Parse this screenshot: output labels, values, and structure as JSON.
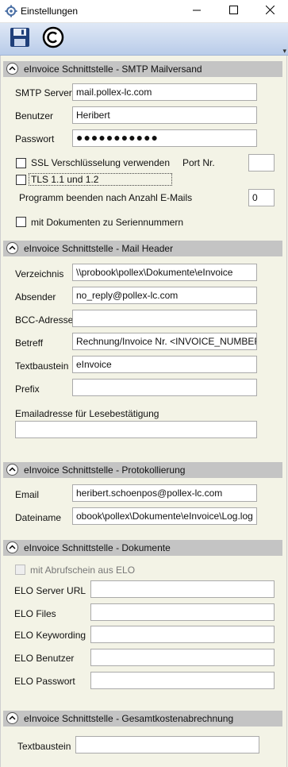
{
  "window": {
    "title": "Einstellungen"
  },
  "toolbar": {
    "overflow_glyph": "▾"
  },
  "smtp": {
    "header": "eInvoice Schnittstelle - SMTP Mailversand",
    "server_label": "SMTP Server",
    "server_value": "mail.pollex-lc.com",
    "user_label": "Benutzer",
    "user_value": "Heribert",
    "password_label": "Passwort",
    "password_value": "●●●●●●●●●●●",
    "ssl_label": "SSL Verschlüsselung verwenden",
    "ssl_checked": false,
    "port_label": "Port Nr.",
    "port_value": "",
    "tls_label": "TLS 1.1 und 1.2",
    "tls_checked": false,
    "quit_label": "Programm beenden nach Anzahl E-Mails",
    "quit_value": "0",
    "serial_label": "mit Dokumenten zu Seriennummern",
    "serial_checked": false
  },
  "mailheader": {
    "header": "eInvoice Schnittstelle - Mail Header",
    "dir_label": "Verzeichnis",
    "dir_value": "\\\\probook\\pollex\\Dokumente\\eInvoice",
    "sender_label": "Absender",
    "sender_value": "no_reply@pollex-lc.com",
    "bcc_label": "BCC-Adresse",
    "bcc_value": "",
    "subject_label": "Betreff",
    "subject_value": "Rechnung/Invoice Nr. <INVOICE_NUMBER>",
    "textblock_label": "Textbaustein",
    "textblock_value": "eInvoice",
    "prefix_label": "Prefix",
    "prefix_value": "",
    "receipt_label": "Emailadresse für Lesebestätigung",
    "receipt_value": ""
  },
  "logging": {
    "header": "eInvoice Schnittstelle - Protokollierung",
    "email_label": "Email",
    "email_value": "heribert.schoenpos@pollex-lc.com",
    "file_label": "Dateiname",
    "file_value": "obook\\pollex\\Dokumente\\eInvoice\\Log.log"
  },
  "documents": {
    "header": "eInvoice Schnittstelle - Dokumente",
    "elo_receipt_label": "mit Abrufschein aus ELO",
    "elo_receipt_checked": false,
    "server_url_label": "ELO Server URL",
    "server_url_value": "",
    "files_label": "ELO Files",
    "files_value": "",
    "keywording_label": "ELO Keywording",
    "keywording_value": "",
    "user_label": "ELO Benutzer",
    "user_value": "",
    "password_label": "ELO Passwort",
    "password_value": ""
  },
  "billing": {
    "header": "eInvoice Schnittstelle - Gesamtkostenabrechnung",
    "textblock_label": "Textbaustein",
    "textblock_value": ""
  },
  "colors": {
    "header_bg": "#c4c4c4",
    "panel_bg": "#f3f3e6",
    "toolbar_top": "#dfe8f6",
    "toolbar_bottom": "#b9cce9"
  }
}
